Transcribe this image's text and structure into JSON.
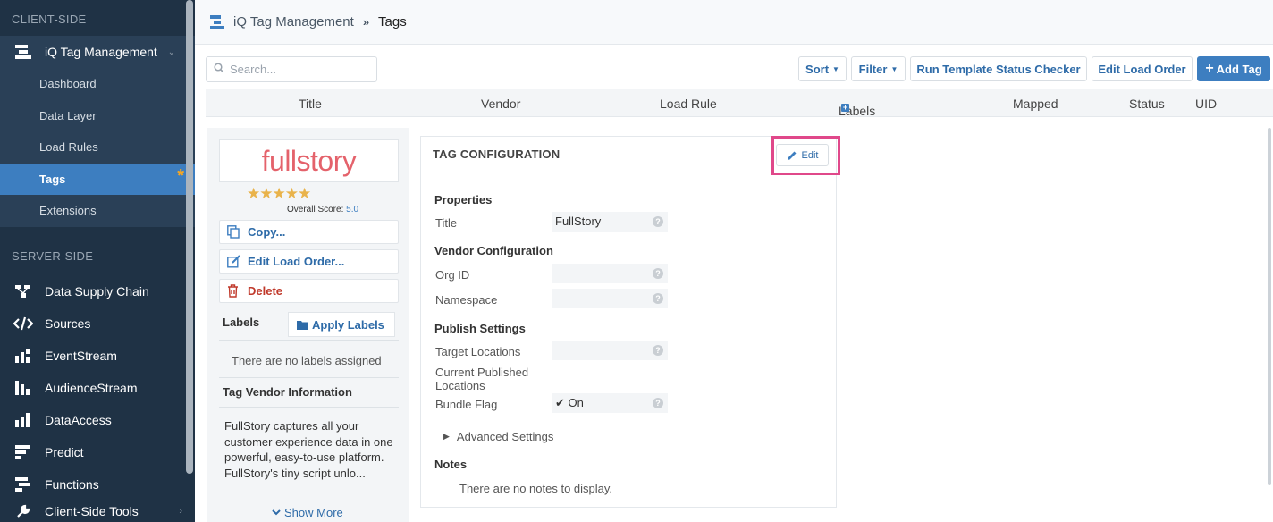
{
  "sidebar": {
    "client_section": "CLIENT-SIDE",
    "tag_management": "iQ Tag Management",
    "sub_items": [
      "Dashboard",
      "Data Layer",
      "Load Rules",
      "Tags",
      "Extensions"
    ],
    "server_section": "SERVER-SIDE",
    "server_items": [
      "Data Supply Chain",
      "Sources",
      "EventStream",
      "AudienceStream",
      "DataAccess",
      "Predict",
      "Functions",
      "Client-Side Tools"
    ],
    "active_star": "*"
  },
  "header": {
    "crumb_root": "iQ Tag Management",
    "crumb_current": "Tags"
  },
  "toolbar": {
    "search_placeholder": "Search...",
    "sort": "Sort",
    "filter": "Filter",
    "run_checker": "Run Template Status Checker",
    "edit_load_order": "Edit Load Order",
    "add_tag": "Add Tag"
  },
  "columns": [
    "Title",
    "Vendor",
    "Load Rule",
    "Labels",
    "Mapped",
    "Status",
    "UID"
  ],
  "detail": {
    "logo_text": "fullstory",
    "stars": "★★★★★",
    "score_label": "Overall Score:",
    "score_value": "5.0",
    "copy": "Copy...",
    "edit_load_order": "Edit Load Order...",
    "delete": "Delete",
    "labels": "Labels",
    "apply_labels": "Apply Labels",
    "no_labels": "There are no labels assigned",
    "vendor_info_title": "Tag Vendor Information",
    "vendor_desc": "FullStory captures all your customer experience data in one powerful, easy-to-use platform. FullStory's tiny script unlo...",
    "show_more": "Show More"
  },
  "config": {
    "title": "TAG CONFIGURATION",
    "edit": "Edit",
    "properties": "Properties",
    "title_label": "Title",
    "title_value": "FullStory",
    "vendor_config": "Vendor Configuration",
    "org_id": "Org ID",
    "namespace": "Namespace",
    "publish_settings": "Publish Settings",
    "target_locations": "Target Locations",
    "current_published": "Current Published Locations",
    "bundle_flag": "Bundle Flag",
    "bundle_value": "On",
    "advanced": "Advanced Settings",
    "notes": "Notes",
    "notes_empty": "There are no notes to display.",
    "help": "?"
  },
  "colors": {
    "sidebar_bg": "#1f3245",
    "active": "#3d7ec0",
    "highlight": "#e0488a",
    "brand_logo": "#e4626b"
  }
}
